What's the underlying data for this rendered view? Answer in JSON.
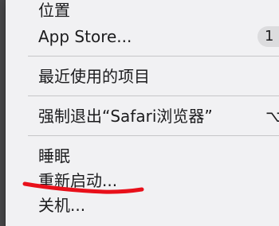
{
  "menu": {
    "location_label": "位置",
    "app_store_label": "App Store...",
    "app_store_badge": "1",
    "recent_items_label": "最近使用的项目",
    "force_quit_label": "强制退出“Safari浏览器”",
    "force_quit_shortcut": "⌥⌘",
    "sleep_label": "睡眠",
    "restart_label": "重新启动...",
    "shutdown_label": "关机..."
  },
  "annotation": {
    "color": "#e8101a",
    "target": "restart"
  }
}
